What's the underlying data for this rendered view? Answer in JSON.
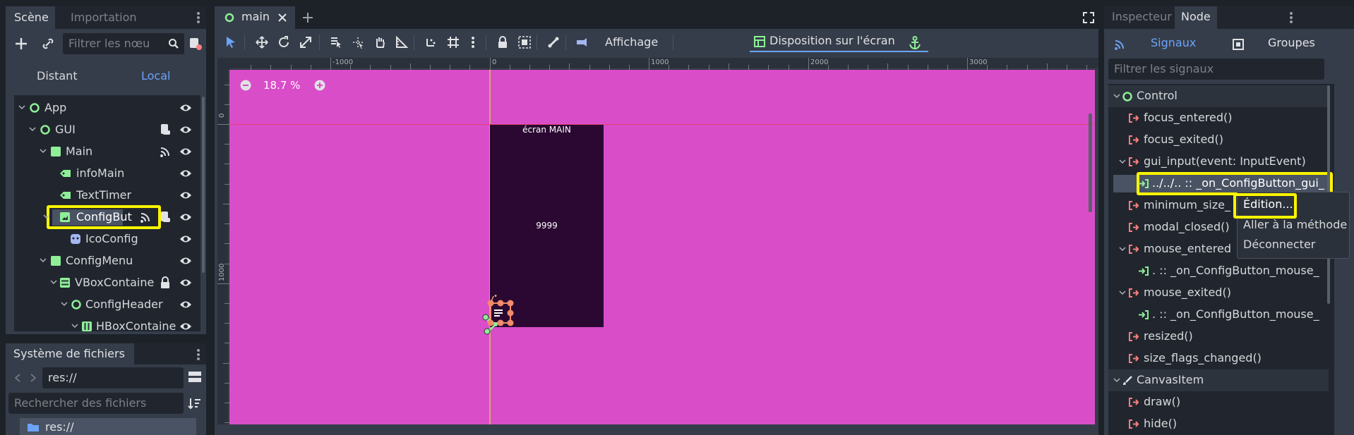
{
  "scene_dock": {
    "tabs": [
      "Scène",
      "Importation"
    ],
    "filter_placeholder": "Filtrer les nœu",
    "remote_tab": "Distant",
    "local_tab": "Local",
    "tree": [
      {
        "label": "App",
        "type": "node",
        "depth": 0,
        "icon": "circle-outline-green"
      },
      {
        "label": "GUI",
        "type": "node",
        "depth": 1,
        "icon": "circle-outline-green",
        "script": true
      },
      {
        "label": "Main",
        "type": "control",
        "depth": 2,
        "icon": "square-green",
        "signals": true
      },
      {
        "label": "infoMain",
        "type": "label",
        "depth": 3,
        "icon": "label-green"
      },
      {
        "label": "TextTimer",
        "type": "label",
        "depth": 3,
        "icon": "label-green"
      },
      {
        "label": "ConfigBut",
        "type": "texturebutton",
        "depth": 2,
        "icon": "texture-button-green",
        "signals": true,
        "script": true,
        "selected": true
      },
      {
        "label": "IcoConfig",
        "type": "sprite",
        "depth": 3,
        "icon": "sprite-purple"
      },
      {
        "label": "ConfigMenu",
        "type": "control",
        "depth": 2,
        "icon": "square-green"
      },
      {
        "label": "VBoxContaine",
        "type": "vbox",
        "depth": 3,
        "icon": "vbox-green",
        "locked": true
      },
      {
        "label": "ConfigHeader",
        "type": "node",
        "depth": 4,
        "icon": "circle-outline-green"
      },
      {
        "label": "HBoxContaine",
        "type": "hbox",
        "depth": 5,
        "icon": "hbox-green"
      }
    ]
  },
  "filesystem_dock": {
    "title": "Système de fichiers",
    "path": "res://",
    "search_placeholder": "Rechercher des fichiers",
    "first_item": "res://"
  },
  "center": {
    "scene_tab": "main",
    "toolbar": {
      "view_menu": "Affichage",
      "layout_menu": "Disposition sur l'écran"
    },
    "zoom": "18.7 %",
    "ruler_top_labels": [
      "-1000",
      "0",
      "1000",
      "2000",
      "3000"
    ],
    "ruler_left_labels": [
      "0",
      "1000"
    ],
    "screen_title": "écran MAIN",
    "screen_value": "9999"
  },
  "right_dock": {
    "tabs": [
      "Inspecteur",
      "Node"
    ],
    "subtabs": [
      "Signaux",
      "Groupes"
    ],
    "filter_placeholder": "Filtrer les signaux",
    "sections": [
      {
        "label": "Control",
        "kind": "section"
      },
      {
        "label": "focus_entered()",
        "kind": "signal"
      },
      {
        "label": "focus_exited()",
        "kind": "signal"
      },
      {
        "label": "gui_input(event: InputEvent)",
        "kind": "signal",
        "expanded": true
      },
      {
        "label": "../../.. :: _on_ConfigButton_gui_",
        "kind": "connection",
        "highlighted": true
      },
      {
        "label": "minimum_size_",
        "kind": "signal"
      },
      {
        "label": "modal_closed()",
        "kind": "signal"
      },
      {
        "label": "mouse_entered",
        "kind": "signal",
        "expanded": true
      },
      {
        "label": ". :: _on_ConfigButton_mouse_",
        "kind": "connection"
      },
      {
        "label": "mouse_exited()",
        "kind": "signal",
        "expanded": true
      },
      {
        "label": ". :: _on_ConfigButton_mouse_",
        "kind": "connection"
      },
      {
        "label": "resized()",
        "kind": "signal"
      },
      {
        "label": "size_flags_changed()",
        "kind": "signal"
      },
      {
        "label": "CanvasItem",
        "kind": "section"
      },
      {
        "label": "draw()",
        "kind": "signal"
      },
      {
        "label": "hide()",
        "kind": "signal"
      }
    ],
    "context_menu": [
      "Édition...",
      "Aller à la méthode",
      "Déconnecter"
    ]
  },
  "colors": {
    "accent": "#6ba4fc",
    "highlight": "#fcf400",
    "viewport": "#d94dc8",
    "signal_icon": "#fc7f7f",
    "node_green": "#8eef97"
  }
}
